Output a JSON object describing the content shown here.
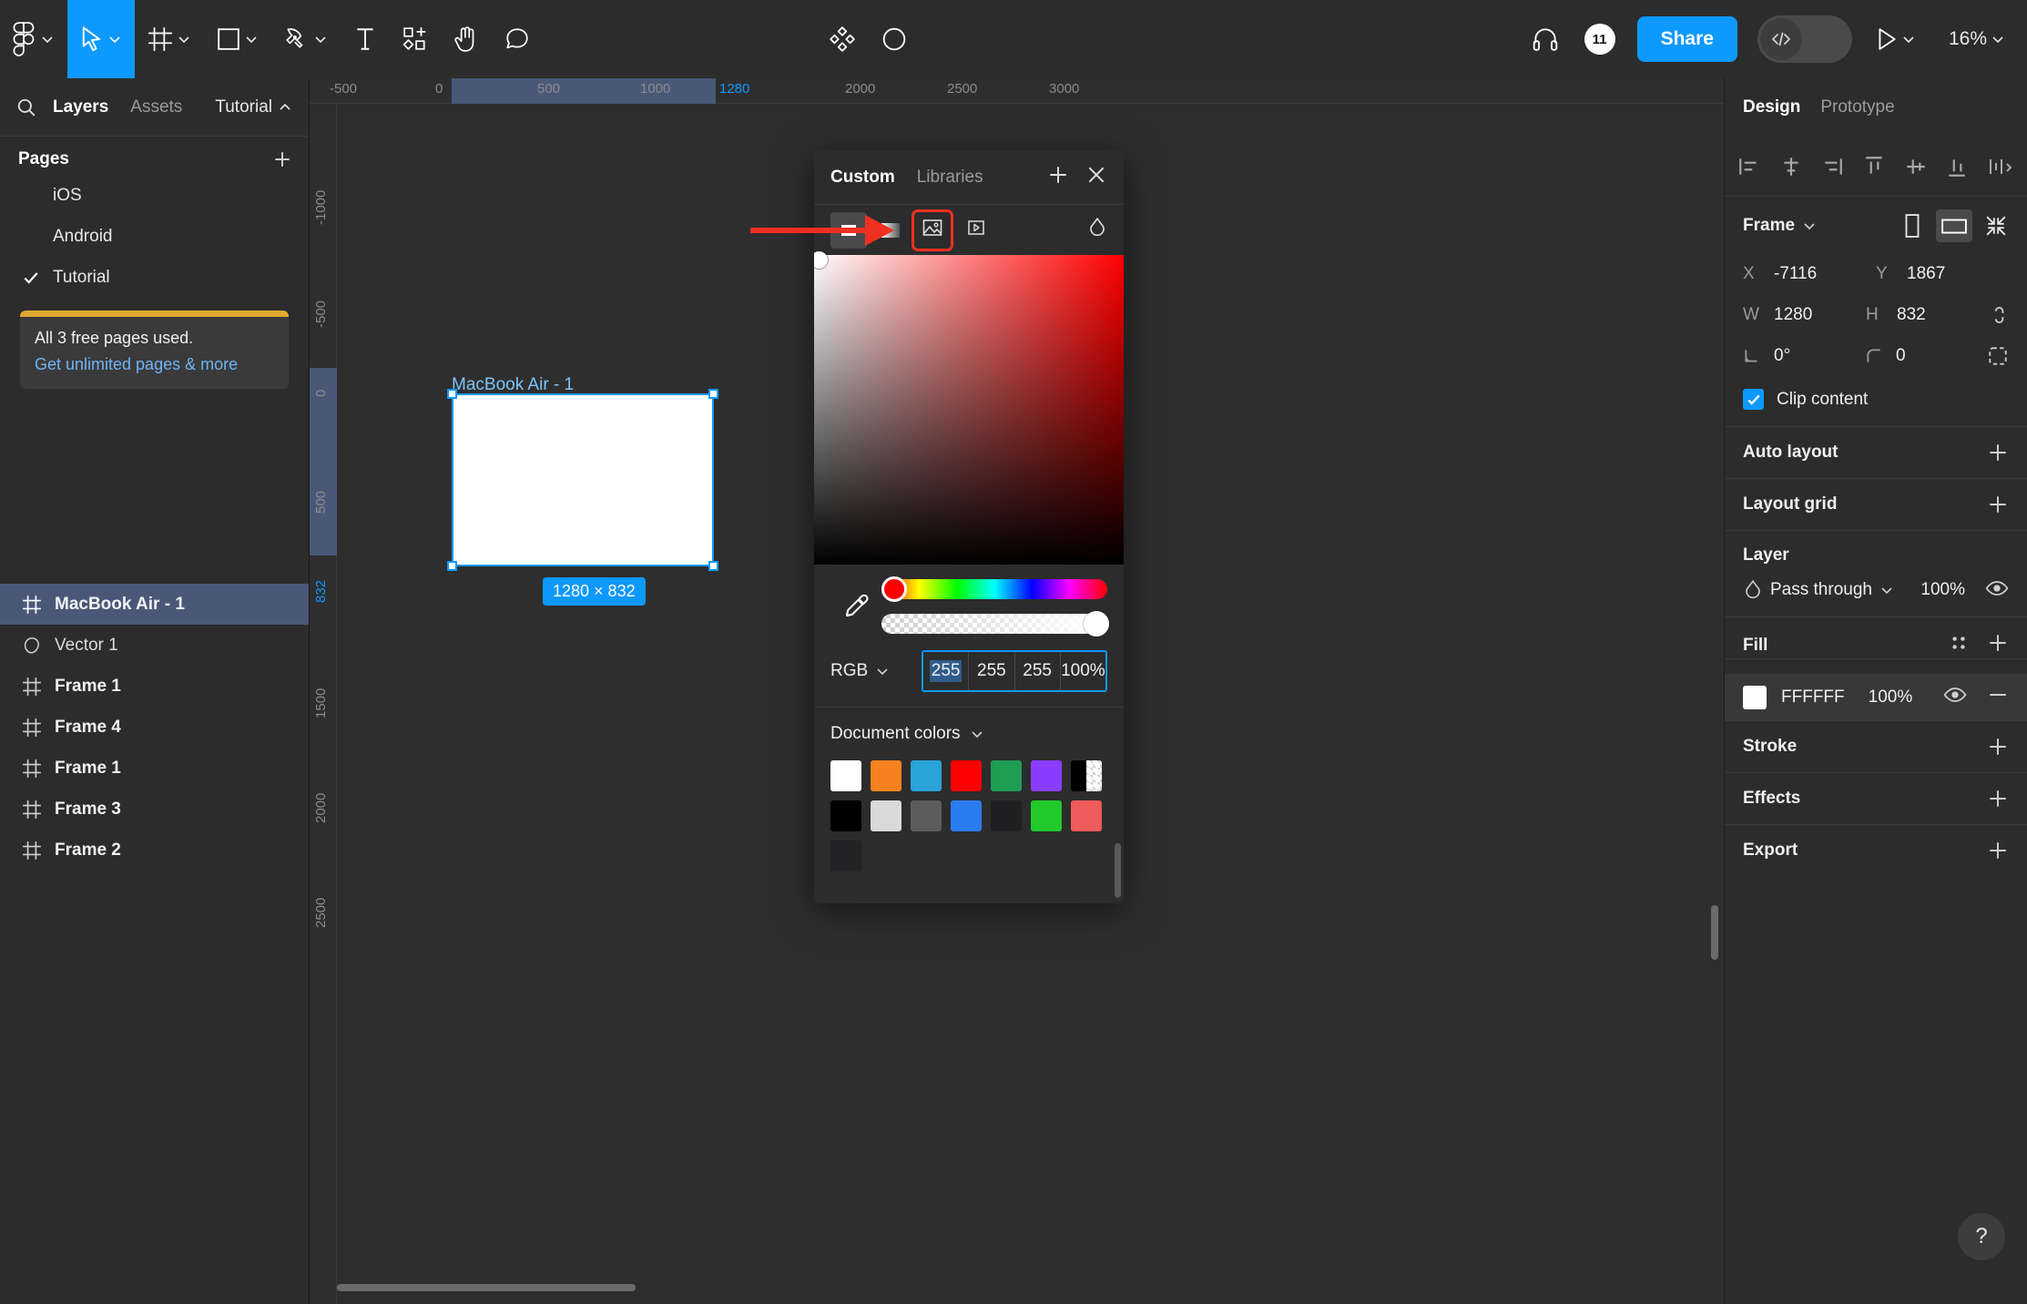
{
  "toolbar": {
    "tools": [
      {
        "name": "figma-menu",
        "icon": "figma-logo",
        "caret": true,
        "active": false
      },
      {
        "name": "move-tool",
        "icon": "cursor",
        "caret": true,
        "active": true
      },
      {
        "name": "frame-tool",
        "icon": "frame",
        "caret": true,
        "active": false
      },
      {
        "name": "shape-tool",
        "icon": "square",
        "caret": true,
        "active": false
      },
      {
        "name": "pen-tool",
        "icon": "pen",
        "caret": true,
        "active": false
      },
      {
        "name": "text-tool",
        "icon": "text-T",
        "caret": false,
        "active": false
      },
      {
        "name": "resources-tool",
        "icon": "components",
        "caret": false,
        "active": false
      },
      {
        "name": "hand-tool",
        "icon": "hand",
        "caret": false,
        "active": false
      },
      {
        "name": "comment-tool",
        "icon": "comment-bubble",
        "caret": false,
        "active": false
      }
    ],
    "center_tools": [
      {
        "name": "actions",
        "icon": "diamond-grid"
      },
      {
        "name": "dev-contrast",
        "icon": "half-circle"
      }
    ],
    "right": {
      "headphones_icon": "headphones",
      "avatar_count": "11",
      "share_label": "Share",
      "devmode_icon": "code-brackets",
      "present_icon": "play-triangle",
      "zoom_level": "16%"
    }
  },
  "left_panel": {
    "tabs": [
      {
        "label": "Layers",
        "active": true
      },
      {
        "label": "Assets",
        "active": false
      }
    ],
    "search_icon": "search-icon",
    "file_name": "Tutorial",
    "pages_title": "Pages",
    "pages_add_icon": "plus-icon",
    "pages": [
      {
        "label": "iOS",
        "current": false
      },
      {
        "label": "Android",
        "current": false
      },
      {
        "label": "Tutorial",
        "current": true
      }
    ],
    "upsell": {
      "line1": "All 3 free pages used.",
      "line2": "Get unlimited pages & more",
      "accent": "#e0a82e"
    },
    "layers": [
      {
        "label": "MacBook Air - 1",
        "icon": "frame-icon",
        "selected": true
      },
      {
        "label": "Vector 1",
        "icon": "vector-icon",
        "selected": false
      },
      {
        "label": "Frame 1",
        "icon": "frame-icon",
        "selected": false
      },
      {
        "label": "Frame 4",
        "icon": "frame-icon",
        "selected": false
      },
      {
        "label": "Frame 1",
        "icon": "frame-icon",
        "selected": false
      },
      {
        "label": "Frame 3",
        "icon": "frame-icon",
        "selected": false
      },
      {
        "label": "Frame 2",
        "icon": "frame-icon",
        "selected": false
      }
    ]
  },
  "canvas": {
    "ruler_h": [
      "-500",
      "0",
      "500",
      "1000",
      "1280",
      "2000",
      "2500",
      "3000"
    ],
    "ruler_v": [
      "-1000",
      "-500",
      "0",
      "500",
      "832",
      "1500",
      "2000",
      "2500"
    ],
    "frame_label": "MacBook Air - 1",
    "size_badge": "1280 × 832",
    "selection_color": "#0d99ff"
  },
  "color_picker": {
    "tabs": [
      {
        "label": "Custom",
        "active": true
      },
      {
        "label": "Libraries",
        "active": false
      }
    ],
    "add_icon": "plus-icon",
    "close_icon": "close-icon",
    "fill_types": [
      {
        "name": "solid-fill",
        "icon": "solid-swatch",
        "selected": true
      },
      {
        "name": "gradient-fill",
        "icon": "gradient-swatch",
        "selected": false
      },
      {
        "name": "image-fill",
        "icon": "image-icon",
        "selected": false,
        "highlighted": true
      },
      {
        "name": "video-fill",
        "icon": "video-icon",
        "selected": false
      }
    ],
    "blend_icon": "blend-drop-icon",
    "eyedropper_icon": "eyedropper-icon",
    "color_model": "RGB",
    "color_model_caret": "chevron-down-icon",
    "channels": [
      {
        "name": "r",
        "value": "255",
        "focused": true
      },
      {
        "name": "g",
        "value": "255",
        "focused": false
      },
      {
        "name": "b",
        "value": "255",
        "focused": false
      },
      {
        "name": "alpha",
        "value": "100%",
        "focused": false
      }
    ],
    "document_colors_label": "Document colors",
    "document_colors_caret": "chevron-down-icon",
    "swatches_row1": [
      "#ffffff",
      "#f5821f",
      "#2aa3d8",
      "#ff0000",
      "#1f9d55",
      "#8b3dff",
      "checker",
      "#000000",
      "#d9d9d9"
    ],
    "swatches_row2": [
      "#5c5c5c",
      "#2a7cf0",
      "#1f1f22",
      "#22c92a",
      "#ef5a5a",
      "#232326"
    ]
  },
  "right_panel": {
    "tabs": [
      {
        "label": "Design",
        "active": true
      },
      {
        "label": "Prototype",
        "active": false
      }
    ],
    "align_buttons": [
      "align-left-icon",
      "align-horizontal-center-icon",
      "align-right-icon",
      "align-top-icon",
      "align-vertical-center-icon",
      "align-bottom-icon",
      "distribute-icon"
    ],
    "frame_section": {
      "title": "Frame",
      "title_caret": "chevron-down-icon",
      "orientation_portrait_icon": "portrait-icon",
      "orientation_landscape_icon": "landscape-icon",
      "resize_icon": "resize-to-fit-icon"
    },
    "properties": {
      "x_label": "X",
      "x_value": "-7116",
      "y_label": "Y",
      "y_value": "1867",
      "w_label": "W",
      "w_value": "1280",
      "h_label": "H",
      "h_value": "832",
      "rotation_icon": "angle-icon",
      "rotation_value": "0°",
      "corner_icon": "corner-radius-icon",
      "corner_value": "0",
      "link_icon": "link-ratio-icon",
      "independent_corners_icon": "independent-corners-icon"
    },
    "clip_content": {
      "label": "Clip content",
      "checked": true
    },
    "sections": [
      {
        "title": "Auto layout",
        "action_icon": "plus-icon"
      },
      {
        "title": "Layout grid",
        "action_icon": "plus-icon"
      }
    ],
    "layer_section": {
      "title": "Layer",
      "blend_icon": "blend-drop-icon",
      "blend_mode": "Pass through",
      "blend_caret": "chevron-down-icon",
      "opacity": "100%",
      "visibility_icon": "eye-icon"
    },
    "fill_section": {
      "title": "Fill",
      "styles_icon": "style-dots-icon",
      "add_icon": "plus-icon",
      "swatch_color": "#ffffff",
      "hex": "FFFFFF",
      "opacity": "100%",
      "visibility_icon": "eye-icon",
      "remove_icon": "minus-icon"
    },
    "bottom_sections": [
      {
        "title": "Stroke",
        "action_icon": "plus-icon"
      },
      {
        "title": "Effects",
        "action_icon": "plus-icon"
      },
      {
        "title": "Export",
        "action_icon": "plus-icon"
      }
    ],
    "help_label": "?"
  },
  "annotation": {
    "arrow_color": "#f03020",
    "highlight_color": "#f03020"
  }
}
